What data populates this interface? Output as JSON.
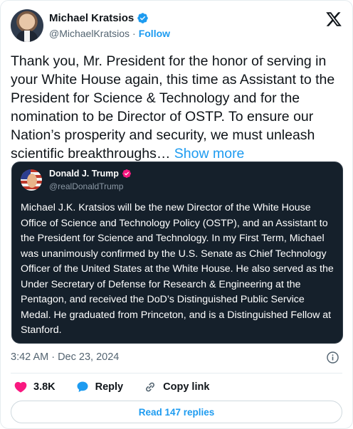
{
  "author": {
    "name": "Michael Kratsios",
    "handle": "@MichaelKratsios",
    "separator": "·",
    "follow_label": "Follow"
  },
  "tweet": {
    "text": "Thank you, Mr. President for the honor of serving in your White House again, this time as Assistant to the President for Science & Technology and for the nomination to be Director of OSTP. To ensure our Nation’s prosperity and security, we must unleash scientific breakthroughs…",
    "show_more_label": "Show more",
    "timestamp": "3:42 AM · Dec 23, 2024"
  },
  "quoted_tweet": {
    "name": "Donald J. Trump",
    "handle": "@realDonaldTrump",
    "text": "Michael J.K. Kratsios will be the new Director of the White House Office of Science and Technology Policy (OSTP), and an Assistant to the President for Science and Technology. In my First Term, Michael was unanimously confirmed by the U.S. Senate as Chief Technology Officer of the United States at the White House. He also served as the Under Secretary of Defense for Research & Engineering at the Pentagon, and received the DoD’s Distinguished Public Service Medal. He graduated from Princeton, and is a Distinguished Fellow at Stanford."
  },
  "actions": {
    "likes_count": "3.8K",
    "reply_label": "Reply",
    "copy_link_label": "Copy link"
  },
  "read_replies_label": "Read 147 replies",
  "icons": {
    "verified": "verified-badge-icon",
    "logo": "x-logo-icon",
    "info": "info-icon",
    "like": "heart-icon",
    "reply": "speech-bubble-icon",
    "copy": "link-icon"
  },
  "colors": {
    "accent": "#1d9bf0",
    "like": "#f91880",
    "quote_bg": "#15202b",
    "secondary_text": "#536471"
  }
}
